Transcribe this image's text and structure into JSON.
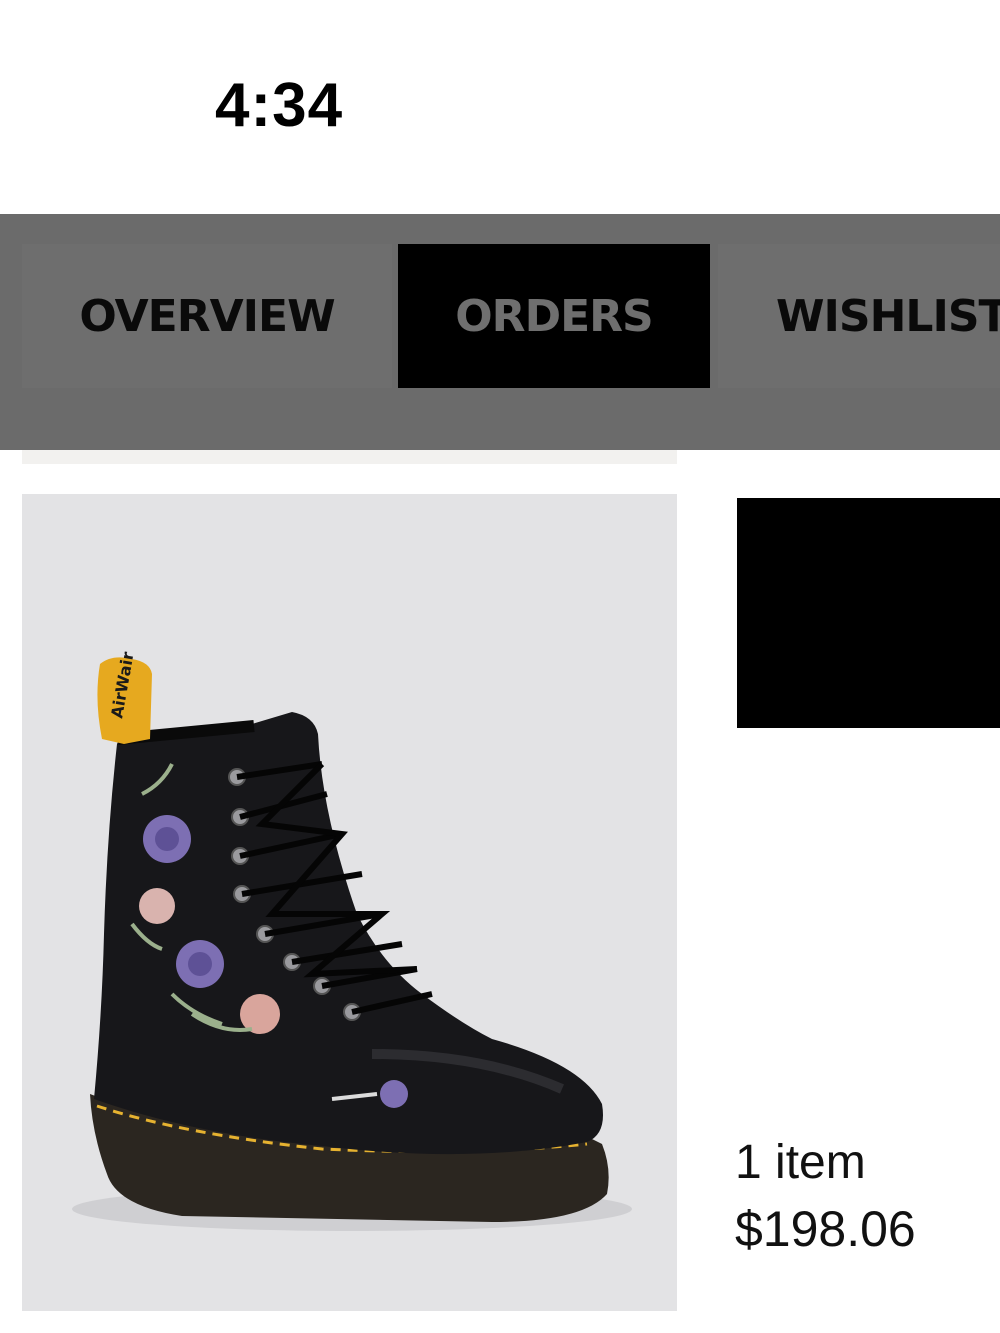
{
  "status_bar": {
    "time": "4:34"
  },
  "tabs": [
    {
      "label": "OVERVIEW",
      "active": false
    },
    {
      "label": "ORDERS",
      "active": true
    },
    {
      "label": "WISHLIST",
      "active": false
    }
  ],
  "order": {
    "product_image": "boot-photo",
    "item_count": "1 item",
    "total": "$198.06"
  },
  "colors": {
    "tabbar_bg": "#6b6b6b",
    "active_tab_bg": "#000000",
    "image_bg": "#e3e3e5"
  }
}
